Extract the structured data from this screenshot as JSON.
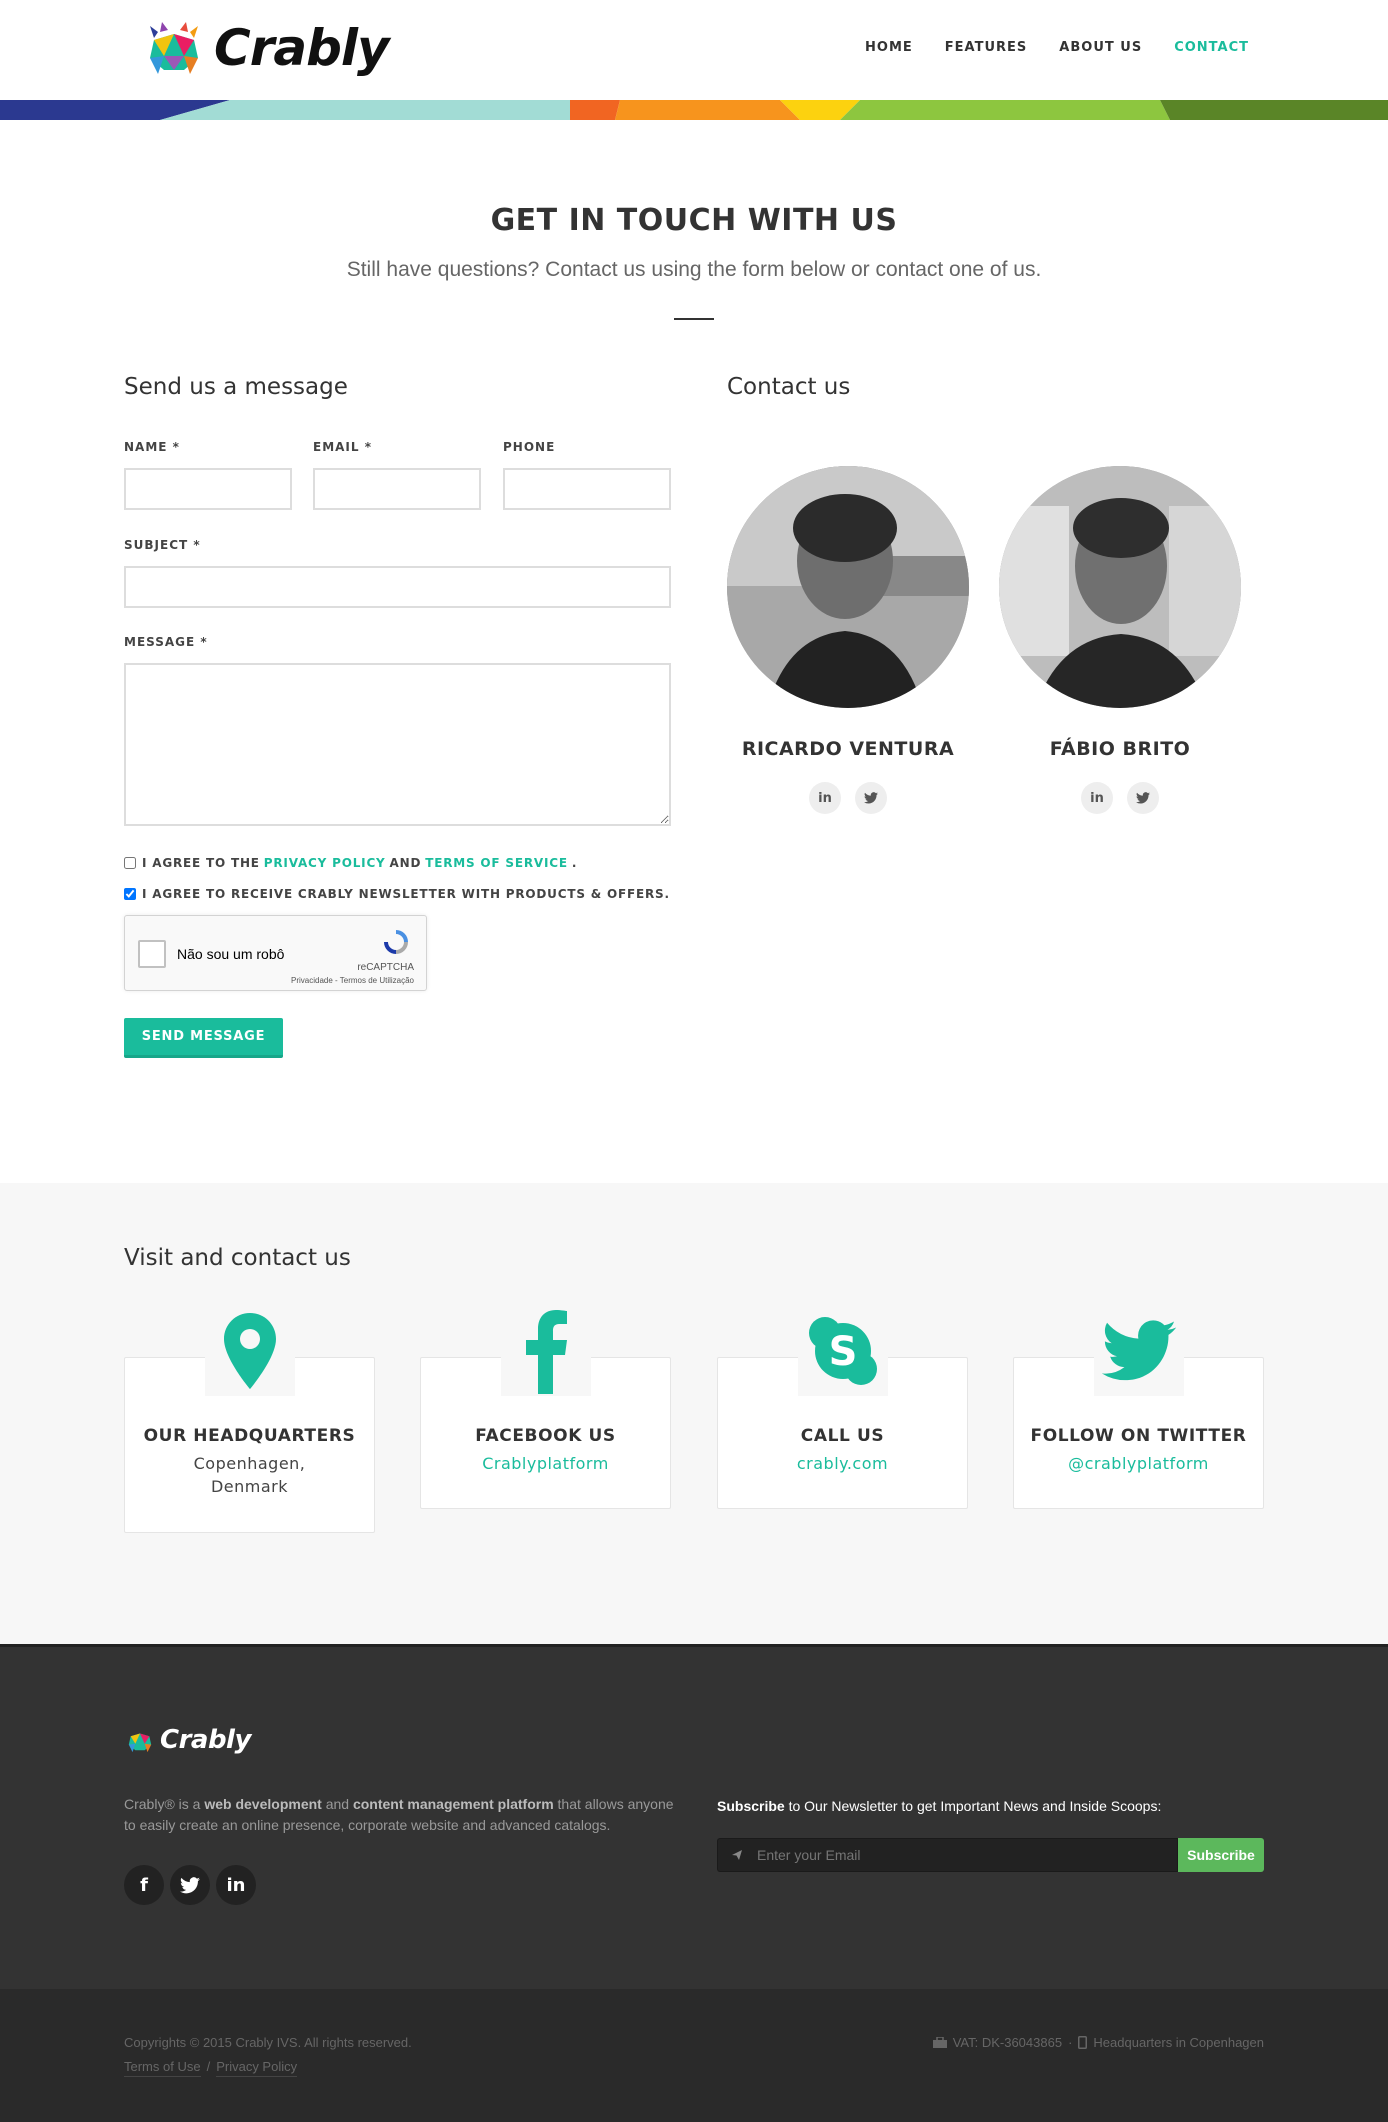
{
  "header": {
    "brand": "Crably",
    "nav": [
      {
        "label": "HOME"
      },
      {
        "label": "FEATURES"
      },
      {
        "label": "ABOUT US"
      },
      {
        "label": "CONTACT"
      }
    ],
    "active_nav": "CONTACT"
  },
  "hero": {
    "title": "GET IN TOUCH WITH US",
    "subtitle": "Still have questions? Contact us using the form below or contact one of us."
  },
  "form": {
    "heading": "Send us a message",
    "name_label": "NAME *",
    "email_label": "EMAIL *",
    "phone_label": "PHONE",
    "subject_label": "SUBJECT *",
    "message_label": "MESSAGE *",
    "name_value": "",
    "email_value": "",
    "phone_value": "",
    "subject_value": "",
    "message_value": "",
    "agree_prefix": "I AGREE TO THE",
    "privacy_link": "PRIVACY POLICY",
    "agree_and": "AND",
    "terms_link": "TERMS OF SERVICE",
    "agree_suffix": ".",
    "agree_checked": false,
    "newsletter_label": "I AGREE TO RECEIVE CRABLY NEWSLETTER WITH PRODUCTS & OFFERS.",
    "newsletter_checked": true,
    "recaptcha": {
      "label": "Não sou um robô",
      "brand": "reCAPTCHA",
      "terms": "Privacidade - Termos de Utilização"
    },
    "send_label": "SEND MESSAGE"
  },
  "contact": {
    "heading": "Contact us",
    "people": [
      {
        "name": "RICARDO VENTURA",
        "social": [
          "in",
          "twitter"
        ]
      },
      {
        "name": "FÁBIO BRITO",
        "social": [
          "in",
          "twitter"
        ]
      }
    ]
  },
  "visit": {
    "heading": "Visit and contact us",
    "cards": [
      {
        "icon": "map-pin-icon",
        "title": "OUR HEADQUARTERS",
        "text": "Copenhagen, Denmark"
      },
      {
        "icon": "facebook-icon",
        "title": "FACEBOOK US",
        "text": "Crablyplatform"
      },
      {
        "icon": "skype-icon",
        "title": "CALL US",
        "text": "crably.com"
      },
      {
        "icon": "twitter-icon",
        "title": "FOLLOW ON TWITTER",
        "text": "@crablyplatform"
      }
    ]
  },
  "footer": {
    "brand": "Crably",
    "desc_1": "Crably® is a ",
    "desc_b1": "web development",
    "desc_2": " and ",
    "desc_b2": "content management platform",
    "desc_3": " that allows anyone to easily create an online presence, corporate website and advanced catalogs.",
    "social": [
      "facebook-icon",
      "twitter-icon",
      "linkedin-icon"
    ],
    "subscribe_bold": "Subscribe",
    "subscribe_rest": " to Our Newsletter to get Important News and Inside Scoops:",
    "subscribe_placeholder": "Enter your Email",
    "subscribe_button": "Subscribe",
    "copyright": "Copyrights © 2015 Crably IVS. All rights reserved.",
    "terms_link": "Terms of Use",
    "privacy_link": "Privacy Policy",
    "link_sep": "/",
    "vat": "VAT: DK-36043865",
    "bullet": "·",
    "hq": "Headquarters in Copenhagen"
  },
  "colors": {
    "accent": "#1abc9c",
    "subscribe_button": "#5cb85c",
    "footer_bg": "#333333"
  }
}
